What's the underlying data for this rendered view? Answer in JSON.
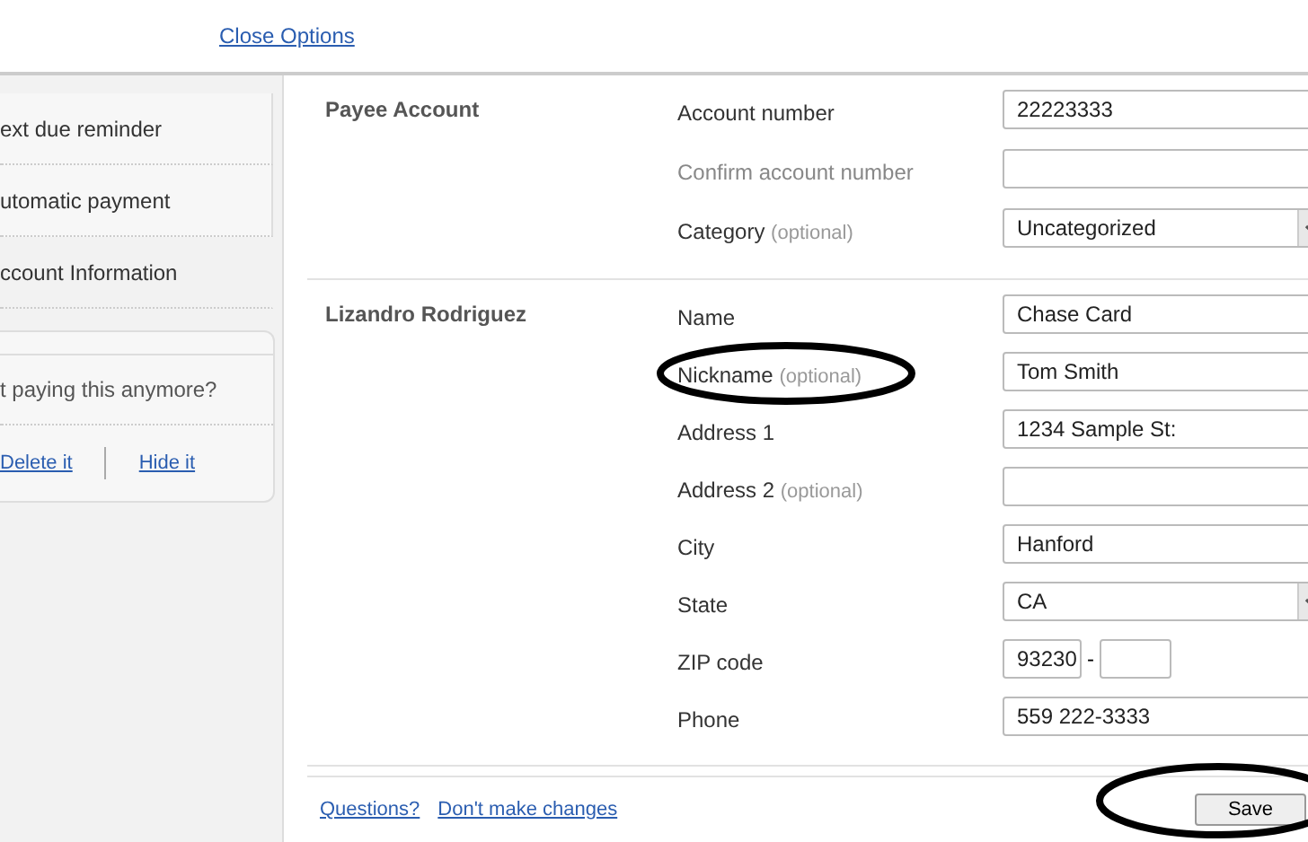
{
  "top_link": "Close Options",
  "sidebar": {
    "options": [
      {
        "label": "ext due reminder",
        "selected": false
      },
      {
        "label": "utomatic payment",
        "selected": false
      },
      {
        "label": "ccount Information",
        "selected": true
      }
    ],
    "stop_box": {
      "question": "t paying this anymore?",
      "links": [
        "Delete it",
        "Hide it"
      ]
    }
  },
  "sections": [
    {
      "title": "Payee Account",
      "fields": [
        {
          "label": "Account number",
          "kind": "text",
          "value": "22223333",
          "disabled": false
        },
        {
          "label": "Confirm account number",
          "kind": "text",
          "disabled": true
        },
        {
          "label": "Category",
          "hint": "(optional)",
          "kind": "select",
          "value": "Uncategorized",
          "disabled": false
        }
      ]
    },
    {
      "title": "Lizandro Rodriguez",
      "fields": [
        {
          "label": "Name",
          "kind": "text",
          "value": "Chase Card",
          "disabled": false
        },
        {
          "label": "Nickname",
          "hint": "(optional)",
          "kind": "text",
          "value": "Tom Smith",
          "disabled": false,
          "circled": true
        },
        {
          "label": "Address 1",
          "kind": "text",
          "value": "1234 Sample St:",
          "disabled": false
        },
        {
          "label": "Address 2",
          "hint": "(optional)",
          "kind": "text",
          "disabled": false
        },
        {
          "label": "City",
          "kind": "text",
          "value": "Hanford",
          "disabled": false
        },
        {
          "label": "State",
          "kind": "select",
          "value": "CA",
          "disabled": false
        },
        {
          "label": "ZIP code",
          "kind": "zip",
          "value": "93230",
          "separator": "-",
          "disabled": false
        },
        {
          "label": "Phone",
          "kind": "text",
          "value": "559 222-3333",
          "disabled": false
        }
      ]
    }
  ],
  "footer": {
    "links": [
      "Questions?",
      "Don't make changes"
    ],
    "save": {
      "label": "Save",
      "circled": true
    }
  }
}
